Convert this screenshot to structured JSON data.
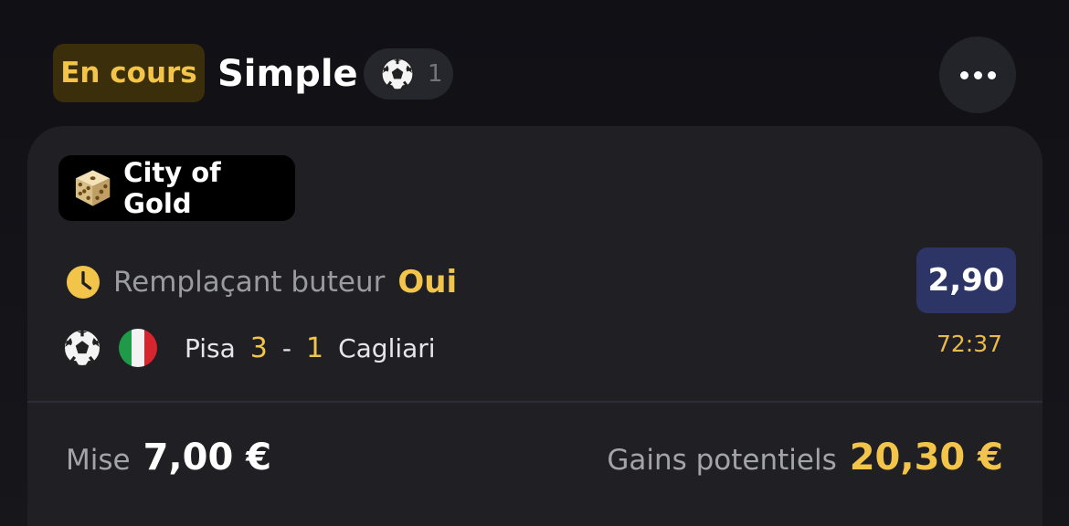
{
  "header": {
    "status_badge": "En cours",
    "title": "Simple",
    "sport_icon": "soccer-ball-icon",
    "selection_count": "1",
    "more_icon": "more-dots-icon"
  },
  "bet": {
    "game": {
      "icon": "dice-icon",
      "label": "City of Gold"
    },
    "selection": {
      "icon": "clock-icon",
      "market": "Remplaçant buteur",
      "value": "Oui",
      "odds": "2,90"
    },
    "match": {
      "sport_icon": "soccer-ball-icon",
      "country_flag": "italy-flag-icon",
      "home_team": "Pisa",
      "home_score": "3",
      "separator": "-",
      "away_score": "1",
      "away_team": "Cagliari",
      "time": "72:37"
    },
    "footer": {
      "stake_label": "Mise",
      "stake_value": "7,00 €",
      "gains_label": "Gains potentiels",
      "gains_value": "20,30 €"
    }
  },
  "colors": {
    "background": "#141419",
    "card": "#1f1f24",
    "accent_gold": "#f2c54a",
    "status_badge_bg": "#3b2e0b",
    "odds_bg": "#2d3466"
  }
}
